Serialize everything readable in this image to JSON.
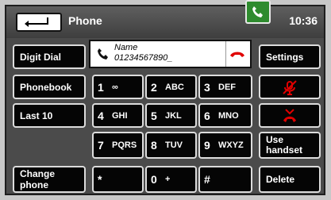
{
  "header": {
    "title": "Phone",
    "time": "10:36"
  },
  "call": {
    "name": "Name",
    "number": "01234567890_"
  },
  "left_buttons": [
    "Digit Dial",
    "Phonebook",
    "Last 10",
    "Change phone"
  ],
  "right_buttons": {
    "settings": "Settings",
    "use_handset": "Use handset",
    "delete": "Delete"
  },
  "keypad": [
    {
      "digit": "1",
      "letters": "∞"
    },
    {
      "digit": "2",
      "letters": "ABC"
    },
    {
      "digit": "3",
      "letters": "DEF"
    },
    {
      "digit": "4",
      "letters": "GHI"
    },
    {
      "digit": "5",
      "letters": "JKL"
    },
    {
      "digit": "6",
      "letters": "MNO"
    },
    {
      "digit": "7",
      "letters": "PQRS"
    },
    {
      "digit": "8",
      "letters": "TUV"
    },
    {
      "digit": "9",
      "letters": "WXYZ"
    },
    {
      "digit": "*",
      "letters": ""
    },
    {
      "digit": "0",
      "letters": "+"
    },
    {
      "digit": "#",
      "letters": ""
    }
  ],
  "icons": {
    "back": "back-arrow-icon",
    "phone": "phone-handset-icon",
    "end_call": "end-call-icon",
    "mute": "mute-microphone-icon",
    "hangup": "hangup-icon"
  },
  "colors": {
    "accent_green": "#2e8b2e",
    "end_red": "#e00000"
  }
}
